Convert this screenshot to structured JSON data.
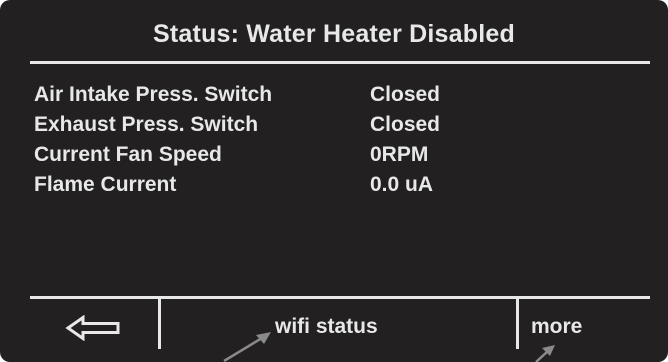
{
  "header": {
    "title": "Status: Water Heater Disabled"
  },
  "status_rows": [
    {
      "label": "Air Intake Press. Switch",
      "value": "Closed"
    },
    {
      "label": "Exhaust Press. Switch",
      "value": "Closed"
    },
    {
      "label": "Current Fan Speed",
      "value": "0RPM"
    },
    {
      "label": "Flame Current",
      "value": "0.0 uA"
    }
  ],
  "footer": {
    "back_icon": "left-arrow-outline",
    "wifi_label": "wifi status",
    "more_label": "more"
  },
  "colors": {
    "screen_background": "#222021",
    "foreground": "#e8e8e8",
    "pointer_arrow": "#8a8a8a"
  }
}
